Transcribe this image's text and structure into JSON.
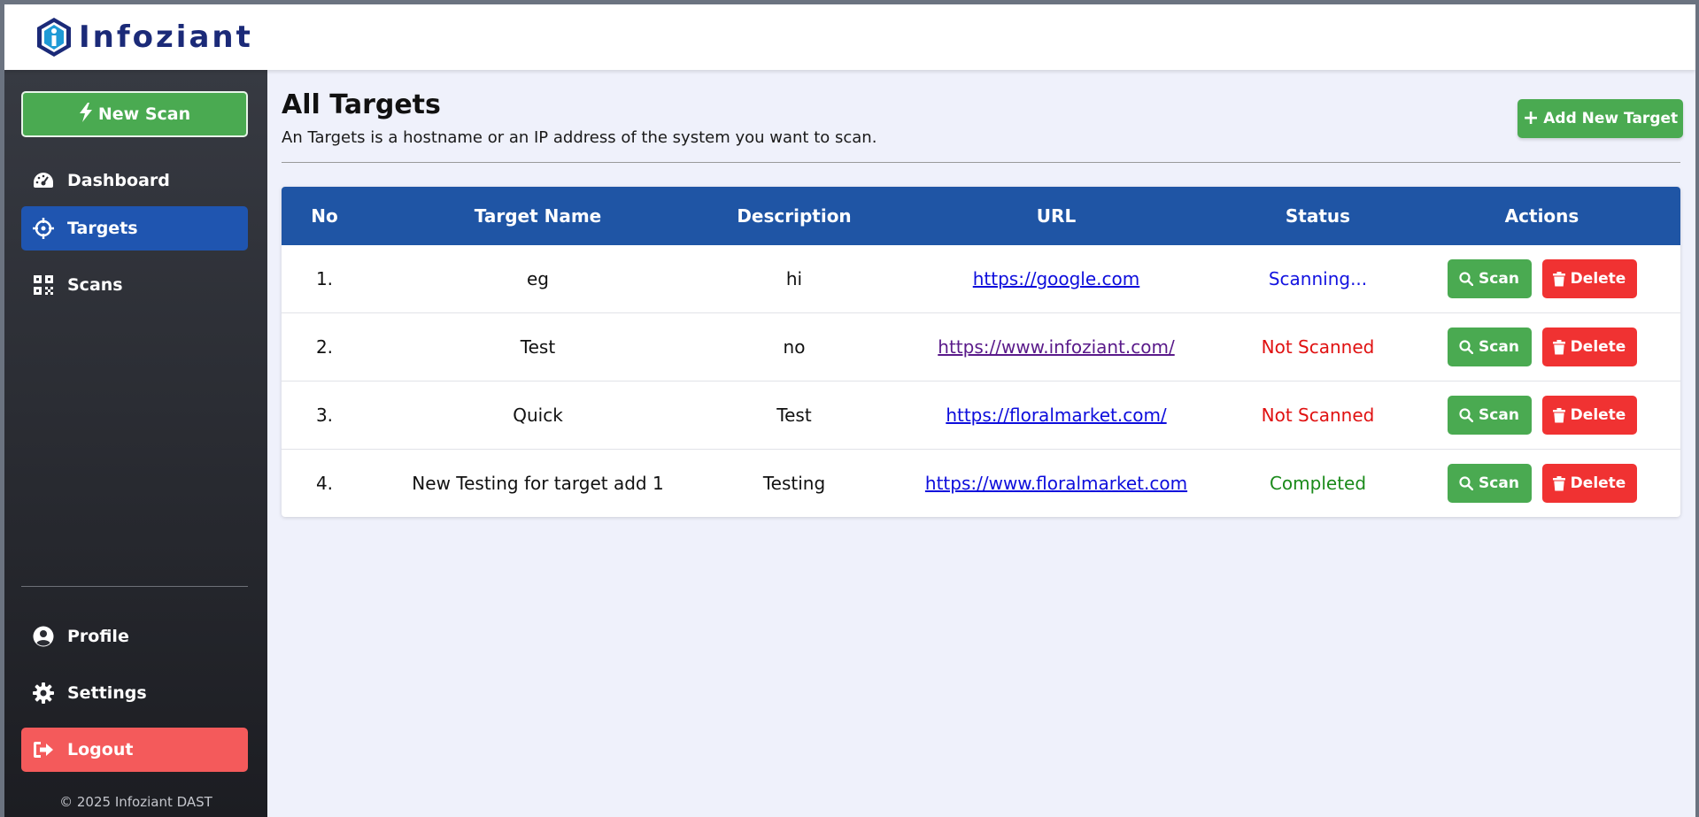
{
  "brand": {
    "name": "Infoziant"
  },
  "sidebar": {
    "new_scan_label": "New Scan",
    "items": [
      {
        "label": "Dashboard",
        "icon": "dashboard-gauge-icon"
      },
      {
        "label": "Targets",
        "icon": "crosshair-icon",
        "active": true
      },
      {
        "label": "Scans",
        "icon": "qr-code-icon"
      }
    ],
    "bottom_items": [
      {
        "label": "Profile",
        "icon": "user-circle-icon"
      },
      {
        "label": "Settings",
        "icon": "gear-icon"
      },
      {
        "label": "Logout",
        "icon": "sign-out-icon"
      }
    ],
    "copyright": "© 2025 Infoziant DAST"
  },
  "page": {
    "title": "All Targets",
    "subtitle": "An Targets is a hostname or an IP address of the system you want to scan.",
    "add_button_label": "Add New Target"
  },
  "table": {
    "columns": [
      "No",
      "Target Name",
      "Description",
      "URL",
      "Status",
      "Actions"
    ],
    "rows": [
      {
        "no": "1.",
        "name": "eg",
        "description": "hi",
        "url": "https://google.com",
        "status": "Scanning...",
        "status_kind": "scanning"
      },
      {
        "no": "2.",
        "name": "Test",
        "description": "no",
        "url": "https://www.infoziant.com/",
        "status": "Not Scanned",
        "status_kind": "not"
      },
      {
        "no": "3.",
        "name": "Quick",
        "description": "Test",
        "url": "https://floralmarket.com/",
        "status": "Not Scanned",
        "status_kind": "not"
      },
      {
        "no": "4.",
        "name": "New Testing for target add 1",
        "description": "Testing",
        "url": "https://www.floralmarket.com",
        "status": "Completed",
        "status_kind": "done"
      }
    ],
    "scan_label": "Scan",
    "delete_label": "Delete"
  },
  "colors": {
    "accent_green": "#4aaa51",
    "header_blue": "#1f55a5",
    "danger_red": "#f03232",
    "logout_red": "#f45a5b"
  }
}
